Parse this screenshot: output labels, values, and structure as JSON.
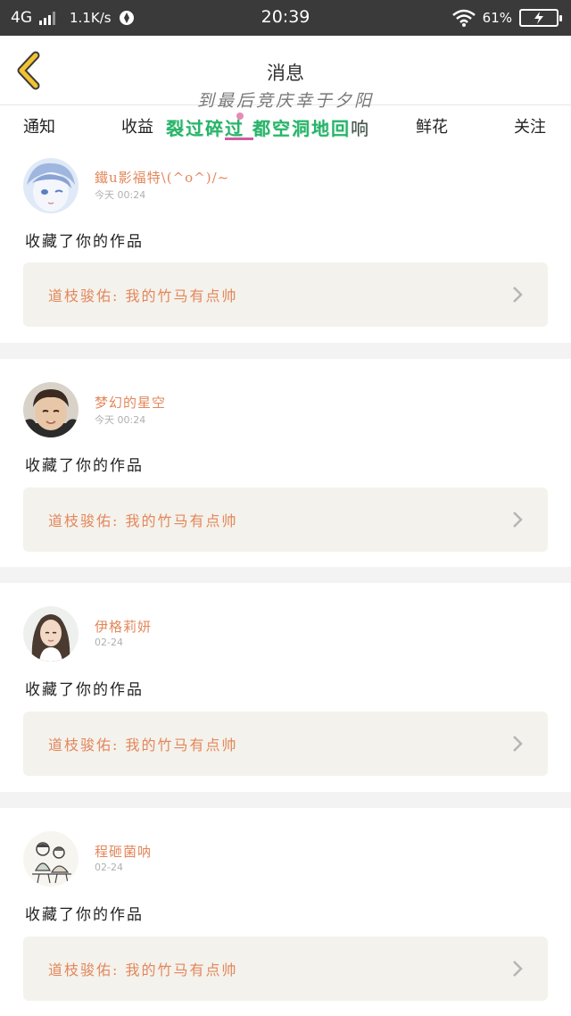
{
  "status_bar": {
    "network": "4G",
    "speed": "1.1K/s",
    "time": "20:39",
    "battery": "61%"
  },
  "header": {
    "title": "消息",
    "overlay_line_1": "到最后竞庆幸于夕阳"
  },
  "tabs": [
    {
      "label": "通知"
    },
    {
      "label": "收益"
    },
    {
      "label": "鲜花"
    },
    {
      "label": "关注"
    }
  ],
  "overlay_line_2": {
    "text": "裂过碎过 都空洞地回",
    "tail": "响"
  },
  "notifications": [
    {
      "user": "鐵u影福特\\(^o^)/~",
      "time": "今天 00:24",
      "action": "收藏了你的作品",
      "work": "道枝骏佑:  我的竹马有点帅",
      "avatar": "avatar-anime-boy"
    },
    {
      "user": "梦幻的星空",
      "time": "今天 00:24",
      "action": "收藏了你的作品",
      "work": "道枝骏佑:  我的竹马有点帅",
      "avatar": "avatar-boy-photo"
    },
    {
      "user": "伊格莉妍",
      "time": "02-24",
      "action": "收藏了你的作品",
      "work": "道枝骏佑:  我的竹马有点帅",
      "avatar": "avatar-girl-photo"
    },
    {
      "user": "程砸菌呐",
      "time": "02-24",
      "action": "收藏了你的作品",
      "work": "道枝骏佑:  我的竹马有点帅",
      "avatar": "avatar-sketch-couple"
    }
  ],
  "colors": {
    "accent_orange": "#e3875b",
    "back_arrow_yellow": "#f2c230",
    "work_box_bg": "#f4f2ec",
    "overlay_green": "#28b36a"
  }
}
